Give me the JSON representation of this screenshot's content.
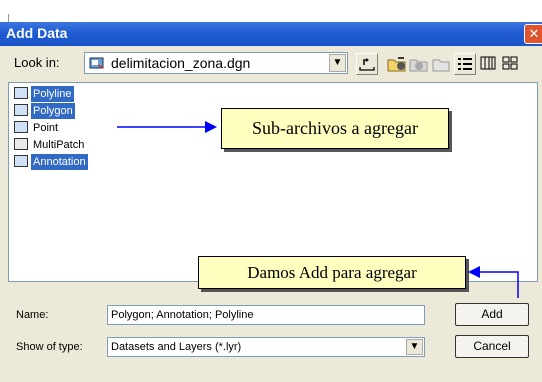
{
  "window": {
    "title": "Add Data",
    "close_glyph": "✕"
  },
  "look_in": {
    "label": "Look in:",
    "value": "delimitacion_zona.dgn",
    "icon": "cad-file-icon"
  },
  "toolbar": {
    "icons": [
      "up-folder-icon",
      "connect-folder-icon",
      "disconnect-folder-icon",
      "new-folder-icon",
      "list-view-icon",
      "details-view-icon",
      "thumbnails-view-icon"
    ]
  },
  "items": [
    {
      "label": "Polyline",
      "selected": true,
      "icon": "polyline-icon"
    },
    {
      "label": "Polygon",
      "selected": true,
      "icon": "polygon-icon"
    },
    {
      "label": "Point",
      "selected": false,
      "icon": "point-icon"
    },
    {
      "label": "MultiPatch",
      "selected": false,
      "icon": "multipatch-icon"
    },
    {
      "label": "Annotation",
      "selected": true,
      "icon": "annotation-icon"
    }
  ],
  "annotations": {
    "sub_archivos": "Sub-archivos a agregar",
    "damos_add": "Damos Add para agregar"
  },
  "name_field": {
    "label": "Name:",
    "value": "Polygon; Annotation; Polyline"
  },
  "type_field": {
    "label": "Show of type:",
    "value": "Datasets and Layers (*.lyr)"
  },
  "buttons": {
    "add": "Add",
    "cancel": "Cancel"
  },
  "colors": {
    "title_bar": "#1f5cd1",
    "selection": "#316ac5",
    "callout_bg": "#ffffc0",
    "arrow": "#0000ff"
  }
}
